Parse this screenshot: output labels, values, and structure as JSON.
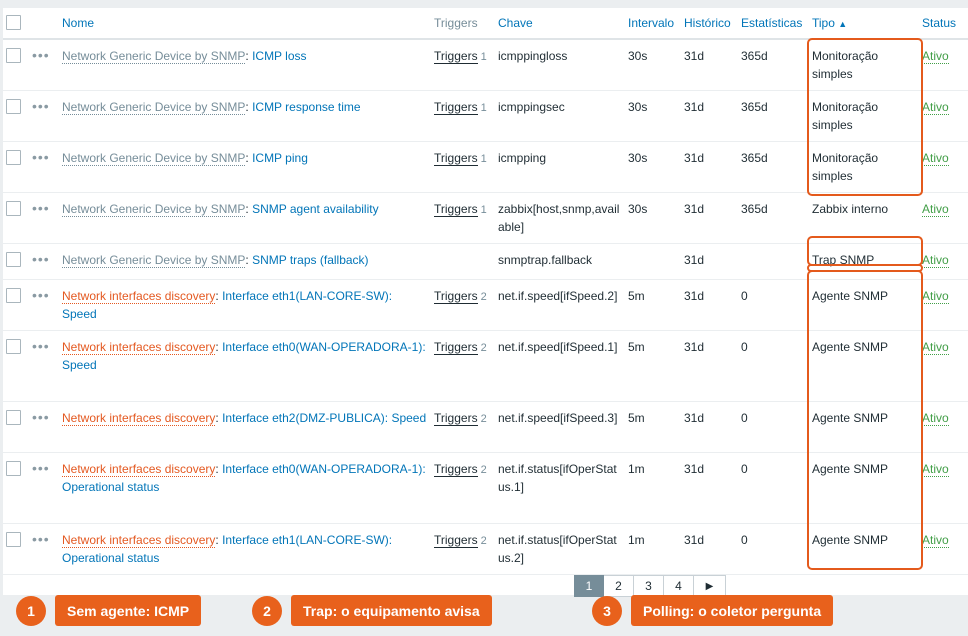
{
  "columns": {
    "name": "Nome",
    "triggers": "Triggers",
    "key": "Chave",
    "interval": "Intervalo",
    "history": "Histórico",
    "trends": "Estatísticas",
    "type": "Tipo",
    "type_sort_icon": "▲",
    "status": "Status"
  },
  "rows": [
    {
      "prefix": "Network Generic Device by SNMP",
      "prefix_kind": "template",
      "name": "ICMP loss",
      "triggers": "Triggers",
      "trigger_count": "1",
      "key": "icmppingloss",
      "interval": "30s",
      "history": "31d",
      "trends": "365d",
      "type": "Monitoração simples",
      "status": "Ativo"
    },
    {
      "prefix": "Network Generic Device by SNMP",
      "prefix_kind": "template",
      "name": "ICMP response time",
      "triggers": "Triggers",
      "trigger_count": "1",
      "key": "icmppingsec",
      "interval": "30s",
      "history": "31d",
      "trends": "365d",
      "type": "Monitoração simples",
      "status": "Ativo"
    },
    {
      "prefix": "Network Generic Device by SNMP",
      "prefix_kind": "template",
      "name": "ICMP ping",
      "triggers": "Triggers",
      "trigger_count": "1",
      "key": "icmpping",
      "interval": "30s",
      "history": "31d",
      "trends": "365d",
      "type": "Monitoração simples",
      "status": "Ativo"
    },
    {
      "prefix": "Network Generic Device by SNMP",
      "prefix_kind": "template",
      "name": "SNMP agent availability",
      "triggers": "Triggers",
      "trigger_count": "1",
      "key": "zabbix[host,snmp,available]",
      "interval": "30s",
      "history": "31d",
      "trends": "365d",
      "type": "Zabbix interno",
      "status": "Ativo"
    },
    {
      "prefix": "Network Generic Device by SNMP",
      "prefix_kind": "template",
      "name": "SNMP traps (fallback)",
      "triggers": "",
      "trigger_count": "",
      "key": "snmptrap.fallback",
      "interval": "",
      "history": "31d",
      "trends": "",
      "type": "Trap SNMP",
      "status": "Ativo"
    },
    {
      "prefix": "Network interfaces discovery",
      "prefix_kind": "discovery",
      "name": "Interface eth1(LAN-CORE-SW): Speed",
      "triggers": "Triggers",
      "trigger_count": "2",
      "key": "net.if.speed[ifSpeed.2]",
      "interval": "5m",
      "history": "31d",
      "trends": "0",
      "type": "Agente SNMP",
      "status": "Ativo"
    },
    {
      "prefix": "Network interfaces discovery",
      "prefix_kind": "discovery",
      "name": "Interface eth0(WAN-OPERADORA-1): Speed",
      "triggers": "Triggers",
      "trigger_count": "2",
      "key": "net.if.speed[ifSpeed.1]",
      "interval": "5m",
      "history": "31d",
      "trends": "0",
      "type": "Agente SNMP",
      "status": "Ativo"
    },
    {
      "prefix": "Network interfaces discovery",
      "prefix_kind": "discovery",
      "name": "Interface eth2(DMZ-PUBLICA): Speed",
      "triggers": "Triggers",
      "trigger_count": "2",
      "key": "net.if.speed[ifSpeed.3]",
      "interval": "5m",
      "history": "31d",
      "trends": "0",
      "type": "Agente SNMP",
      "status": "Ativo"
    },
    {
      "prefix": "Network interfaces discovery",
      "prefix_kind": "discovery",
      "name": "Interface eth0(WAN-OPERADORA-1): Operational status",
      "triggers": "Triggers",
      "trigger_count": "2",
      "key": "net.if.status[ifOperStatus.1]",
      "interval": "1m",
      "history": "31d",
      "trends": "0",
      "type": "Agente SNMP",
      "status": "Ativo"
    },
    {
      "prefix": "Network interfaces discovery",
      "prefix_kind": "discovery",
      "name": "Interface eth1(LAN-CORE-SW): Operational status",
      "triggers": "Triggers",
      "trigger_count": "2",
      "key": "net.if.status[ifOperStatus.2]",
      "interval": "1m",
      "history": "31d",
      "trends": "0",
      "type": "Agente SNMP",
      "status": "Ativo"
    }
  ],
  "pagination": {
    "pages": [
      "1",
      "2",
      "3",
      "4"
    ],
    "active": "1",
    "next_icon": "▶"
  },
  "callouts": [
    {
      "number": "1",
      "label": "Sem agente: ICMP"
    },
    {
      "number": "2",
      "label": "Trap: o equipamento avisa"
    },
    {
      "number": "3",
      "label": "Polling: o coletor pergunta"
    }
  ],
  "colors": {
    "link": "#0275b8",
    "template": "#768d99",
    "discovery": "#e45921",
    "status_active": "#429e47",
    "highlight": "#e45a1c"
  }
}
